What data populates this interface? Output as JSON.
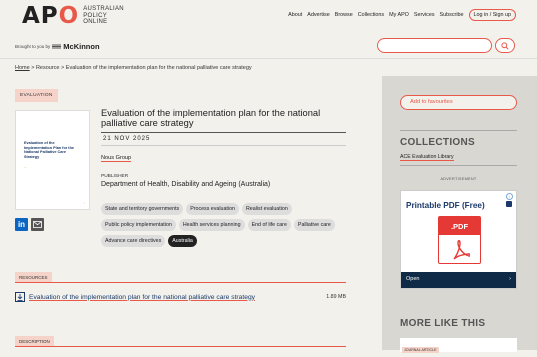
{
  "header": {
    "logo_text": "APO",
    "logo_sub": [
      "AUSTRALIAN",
      "POLICY",
      "ONLINE"
    ],
    "nav": [
      "About",
      "Advertise",
      "Browse",
      "Collections",
      "My APO",
      "Services",
      "Subscribe"
    ],
    "login_label": "Log in / Sign up",
    "brought_prefix": "Brought to you by",
    "sponsor": "McKinnon"
  },
  "search": {
    "placeholder": ""
  },
  "breadcrumb": {
    "home": "Home",
    "sep": ">",
    "resource": "Resource",
    "current": "Evaluation of the implementation plan for the national palliative care strategy"
  },
  "item": {
    "type_tag": "EVALUATION",
    "cover_title": "Evaluation of the Implementation Plan for the National Palliative Care Strategy",
    "title": "Evaluation of the implementation plan for the national palliative care strategy",
    "date": "21 NOV 2025",
    "author": "Nous Group",
    "publisher_label": "PUBLISHER",
    "publisher": "Department of Health, Disability and Ageing (Australia)",
    "tags": [
      "State and territory governments",
      "Process evaluation",
      "Realist evaluation",
      "Public policy implementation",
      "Health services planning",
      "End of life care",
      "Palliative care",
      "Advance care directives",
      "Australia"
    ]
  },
  "resources": {
    "label": "RESOURCES",
    "file_name": "Evaluation of the implementation plan for the national palliative care strategy",
    "file_size": "1.89 MB"
  },
  "description": {
    "label": "DESCRIPTION"
  },
  "sidebar": {
    "favourites_label": "Add to favourites",
    "collections_heading": "COLLECTIONS",
    "collection_item": "ACE Evaluation Library",
    "advert_label": "ADVERTISEMENT",
    "ad_title": "Printable PDF (Free)",
    "ad_pdf_label": ".PDF",
    "ad_cta": "Open",
    "ad_arrow": "›",
    "more_heading": "MORE LIKE THIS",
    "journal_tag": "JOURNAL ARTICLE"
  }
}
